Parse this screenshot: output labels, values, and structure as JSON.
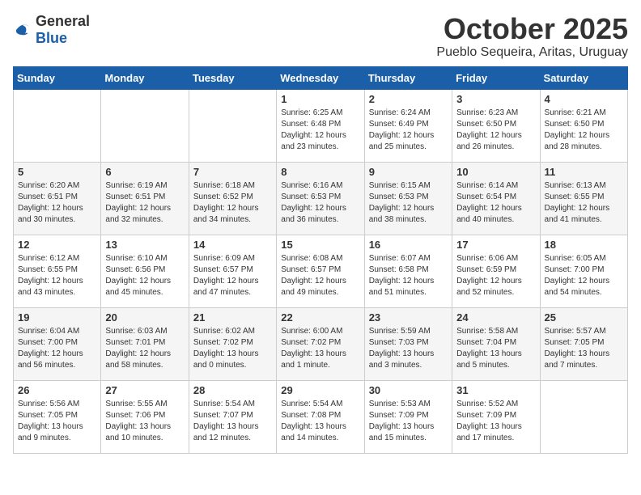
{
  "header": {
    "logo_general": "General",
    "logo_blue": "Blue",
    "month": "October 2025",
    "location": "Pueblo Sequeira, Aritas, Uruguay"
  },
  "calendar": {
    "days_of_week": [
      "Sunday",
      "Monday",
      "Tuesday",
      "Wednesday",
      "Thursday",
      "Friday",
      "Saturday"
    ],
    "weeks": [
      [
        {
          "day": "",
          "info": ""
        },
        {
          "day": "",
          "info": ""
        },
        {
          "day": "",
          "info": ""
        },
        {
          "day": "1",
          "info": "Sunrise: 6:25 AM\nSunset: 6:48 PM\nDaylight: 12 hours\nand 23 minutes."
        },
        {
          "day": "2",
          "info": "Sunrise: 6:24 AM\nSunset: 6:49 PM\nDaylight: 12 hours\nand 25 minutes."
        },
        {
          "day": "3",
          "info": "Sunrise: 6:23 AM\nSunset: 6:50 PM\nDaylight: 12 hours\nand 26 minutes."
        },
        {
          "day": "4",
          "info": "Sunrise: 6:21 AM\nSunset: 6:50 PM\nDaylight: 12 hours\nand 28 minutes."
        }
      ],
      [
        {
          "day": "5",
          "info": "Sunrise: 6:20 AM\nSunset: 6:51 PM\nDaylight: 12 hours\nand 30 minutes."
        },
        {
          "day": "6",
          "info": "Sunrise: 6:19 AM\nSunset: 6:51 PM\nDaylight: 12 hours\nand 32 minutes."
        },
        {
          "day": "7",
          "info": "Sunrise: 6:18 AM\nSunset: 6:52 PM\nDaylight: 12 hours\nand 34 minutes."
        },
        {
          "day": "8",
          "info": "Sunrise: 6:16 AM\nSunset: 6:53 PM\nDaylight: 12 hours\nand 36 minutes."
        },
        {
          "day": "9",
          "info": "Sunrise: 6:15 AM\nSunset: 6:53 PM\nDaylight: 12 hours\nand 38 minutes."
        },
        {
          "day": "10",
          "info": "Sunrise: 6:14 AM\nSunset: 6:54 PM\nDaylight: 12 hours\nand 40 minutes."
        },
        {
          "day": "11",
          "info": "Sunrise: 6:13 AM\nSunset: 6:55 PM\nDaylight: 12 hours\nand 41 minutes."
        }
      ],
      [
        {
          "day": "12",
          "info": "Sunrise: 6:12 AM\nSunset: 6:55 PM\nDaylight: 12 hours\nand 43 minutes."
        },
        {
          "day": "13",
          "info": "Sunrise: 6:10 AM\nSunset: 6:56 PM\nDaylight: 12 hours\nand 45 minutes."
        },
        {
          "day": "14",
          "info": "Sunrise: 6:09 AM\nSunset: 6:57 PM\nDaylight: 12 hours\nand 47 minutes."
        },
        {
          "day": "15",
          "info": "Sunrise: 6:08 AM\nSunset: 6:57 PM\nDaylight: 12 hours\nand 49 minutes."
        },
        {
          "day": "16",
          "info": "Sunrise: 6:07 AM\nSunset: 6:58 PM\nDaylight: 12 hours\nand 51 minutes."
        },
        {
          "day": "17",
          "info": "Sunrise: 6:06 AM\nSunset: 6:59 PM\nDaylight: 12 hours\nand 52 minutes."
        },
        {
          "day": "18",
          "info": "Sunrise: 6:05 AM\nSunset: 7:00 PM\nDaylight: 12 hours\nand 54 minutes."
        }
      ],
      [
        {
          "day": "19",
          "info": "Sunrise: 6:04 AM\nSunset: 7:00 PM\nDaylight: 12 hours\nand 56 minutes."
        },
        {
          "day": "20",
          "info": "Sunrise: 6:03 AM\nSunset: 7:01 PM\nDaylight: 12 hours\nand 58 minutes."
        },
        {
          "day": "21",
          "info": "Sunrise: 6:02 AM\nSunset: 7:02 PM\nDaylight: 13 hours\nand 0 minutes."
        },
        {
          "day": "22",
          "info": "Sunrise: 6:00 AM\nSunset: 7:02 PM\nDaylight: 13 hours\nand 1 minute."
        },
        {
          "day": "23",
          "info": "Sunrise: 5:59 AM\nSunset: 7:03 PM\nDaylight: 13 hours\nand 3 minutes."
        },
        {
          "day": "24",
          "info": "Sunrise: 5:58 AM\nSunset: 7:04 PM\nDaylight: 13 hours\nand 5 minutes."
        },
        {
          "day": "25",
          "info": "Sunrise: 5:57 AM\nSunset: 7:05 PM\nDaylight: 13 hours\nand 7 minutes."
        }
      ],
      [
        {
          "day": "26",
          "info": "Sunrise: 5:56 AM\nSunset: 7:05 PM\nDaylight: 13 hours\nand 9 minutes."
        },
        {
          "day": "27",
          "info": "Sunrise: 5:55 AM\nSunset: 7:06 PM\nDaylight: 13 hours\nand 10 minutes."
        },
        {
          "day": "28",
          "info": "Sunrise: 5:54 AM\nSunset: 7:07 PM\nDaylight: 13 hours\nand 12 minutes."
        },
        {
          "day": "29",
          "info": "Sunrise: 5:54 AM\nSunset: 7:08 PM\nDaylight: 13 hours\nand 14 minutes."
        },
        {
          "day": "30",
          "info": "Sunrise: 5:53 AM\nSunset: 7:09 PM\nDaylight: 13 hours\nand 15 minutes."
        },
        {
          "day": "31",
          "info": "Sunrise: 5:52 AM\nSunset: 7:09 PM\nDaylight: 13 hours\nand 17 minutes."
        },
        {
          "day": "",
          "info": ""
        }
      ]
    ]
  }
}
